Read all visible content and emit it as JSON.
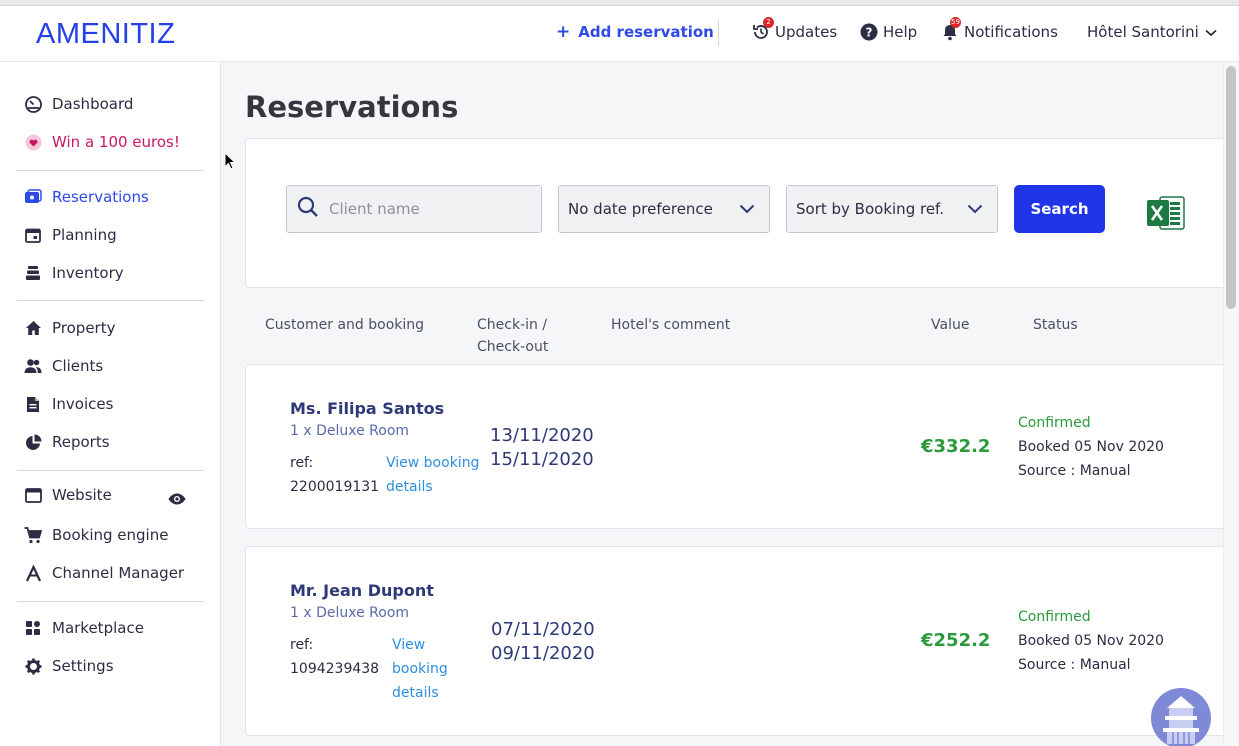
{
  "header": {
    "logo": "AMENITIZ",
    "add_reservation": "Add reservation",
    "updates": "Updates",
    "updates_count": "2",
    "help": "Help",
    "notifications": "Notifications",
    "notifications_count": "59",
    "hotel": "Hôtel Santorini"
  },
  "sidebar": {
    "dashboard": "Dashboard",
    "promo": "Win a 100 euros!",
    "reservations": "Reservations",
    "planning": "Planning",
    "inventory": "Inventory",
    "property": "Property",
    "clients": "Clients",
    "invoices": "Invoices",
    "reports": "Reports",
    "website": "Website",
    "booking_engine": "Booking engine",
    "channel_manager": "Channel Manager",
    "marketplace": "Marketplace",
    "settings": "Settings"
  },
  "main": {
    "title": "Reservations",
    "search_placeholder": "Client name",
    "date_filter": "No date preference",
    "sort_filter": "Sort by Booking ref.",
    "search_button": "Search",
    "columns": {
      "customer": "Customer and booking",
      "checkin_1": "Check-in /",
      "checkin_2": "Check-out",
      "comment": "Hotel's comment",
      "value": "Value",
      "status": "Status"
    },
    "reservations": [
      {
        "name": "Ms. Filipa Santos",
        "room": "1 x Deluxe Room",
        "ref_label": "ref:",
        "ref": "2200019131",
        "link_1": "View booking",
        "link_2": "details",
        "checkin": "13/11/2020",
        "checkout": "15/11/2020",
        "value": "€332.2",
        "status": "Confirmed",
        "booked": "Booked 05 Nov 2020",
        "source": "Source : Manual"
      },
      {
        "name": "Mr. Jean Dupont",
        "room": "1 x Deluxe Room",
        "ref_label": "ref:",
        "ref": "1094239438",
        "link_1": "View",
        "link_2": "booking",
        "link_3": "details",
        "checkin": "07/11/2020",
        "checkout": "09/11/2020",
        "value": "€252.2",
        "status": "Confirmed",
        "booked": "Booked 05 Nov 2020",
        "source": "Source : Manual"
      }
    ]
  },
  "colors": {
    "brand": "#2540e8",
    "primary_button": "#2135e8",
    "confirmed": "#2a9a3a",
    "promo": "#c8185f"
  }
}
